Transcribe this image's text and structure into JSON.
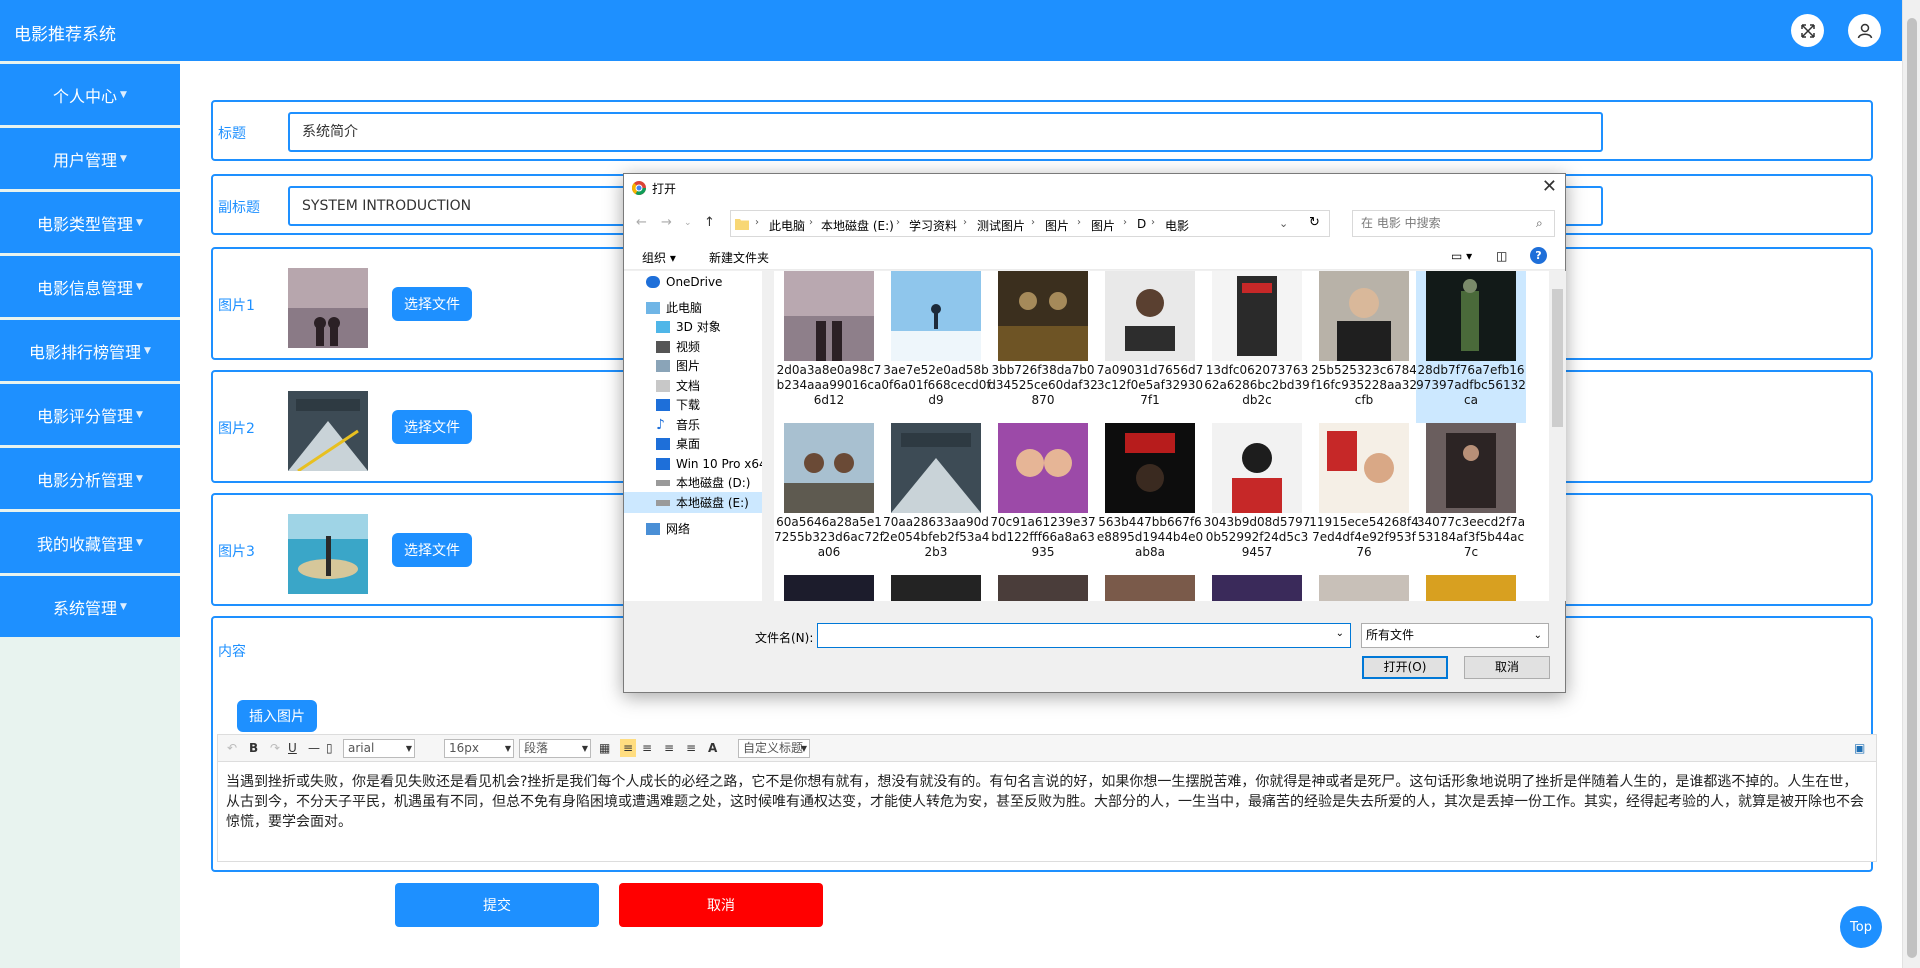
{
  "app": {
    "title": "电影推荐系统"
  },
  "sidebar": {
    "items": [
      {
        "label": "个人中心"
      },
      {
        "label": "用户管理"
      },
      {
        "label": "电影类型管理"
      },
      {
        "label": "电影信息管理"
      },
      {
        "label": "电影排行榜管理"
      },
      {
        "label": "电影评分管理"
      },
      {
        "label": "电影分析管理"
      },
      {
        "label": "我的收藏管理"
      },
      {
        "label": "系统管理"
      }
    ]
  },
  "form": {
    "title_label": "标题",
    "title_value": "系统简介",
    "subtitle_label": "副标题",
    "subtitle_value": "SYSTEM INTRODUCTION",
    "image1_label": "图片1",
    "image2_label": "图片2",
    "image3_label": "图片3",
    "choose_file": "选择文件",
    "content_label": "内容",
    "insert_image": "插入图片",
    "submit": "提交",
    "cancel": "取消"
  },
  "editor": {
    "font": "arial",
    "size": "16px",
    "paragraph": "段落",
    "custom_title": "自定义标题",
    "text": "当遇到挫折或失败，你是看见失败还是看见机会?挫折是我们每个人成长的必经之路，它不是你想有就有，想没有就没有的。有句名言说的好，如果你想一生摆脱苦难，你就得是神或者是死尸。这句话形象地说明了挫折是伴随着人生的，是谁都逃不掉的。人生在世，从古到今，不分天子平民，机遇虽有不同，但总不免有身陷困境或遭遇难题之处，这时候唯有通权达变，才能使人转危为安，甚至反败为胜。大部分的人，一生当中，最痛苦的经验是失去所爱的人，其次是丢掉一份工作。其实，经得起考验的人，就算是被开除也不会惊慌，要学会面对。"
  },
  "top_button": "Top",
  "dialog": {
    "title": "打开",
    "breadcrumb": [
      "此电脑",
      "本地磁盘 (E:)",
      "学习资料",
      "测试图片",
      "图片",
      "图片",
      "D",
      "电影"
    ],
    "search_placeholder": "在 电影 中搜索",
    "organize": "组织",
    "new_folder": "新建文件夹",
    "tree": [
      "OneDrive",
      "此电脑",
      "3D 对象",
      "视频",
      "图片",
      "文档",
      "下载",
      "音乐",
      "桌面",
      "Win 10 Pro x64",
      "本地磁盘 (D:)",
      "本地磁盘 (E:)",
      "网络"
    ],
    "files": [
      "2d0a3a8e0a98c7b234aaa99016ca6d12",
      "3ae7e52e0ad58b0f6a01f668cecd0fd9",
      "3bb726f38da7b0d34525ce60daf32870",
      "7a09031d7656d73c12f0e5af329307f1",
      "13dfc06207376362a6286bc2bd39db2c",
      "25b525323c6784f16fc935228aa32cfb",
      "28db7f76a7efb1697397adfbc56132ca",
      "60a5646a28a5e17255b323d6ac72fa06",
      "70aa28633aa90d2e054bfeb2f53a42b3",
      "70c91a61239e37bd122fff66a8a63935",
      "563b447bb667f6e8895d1944b4e0ab8a",
      "3043b9d08d57970b52992f24d5c39457",
      "11915ece54268f47ed4df4e92f953f76",
      "34077c3eecd2f7a53184af3f5b44ac7c"
    ],
    "filename_label": "文件名(N):",
    "filetype": "所有文件",
    "open": "打开(O)",
    "cancel": "取消"
  },
  "colors": {
    "primary": "#1e90ff",
    "danger": "#ff0000",
    "sidebar_bg": "#e8f3ef"
  }
}
